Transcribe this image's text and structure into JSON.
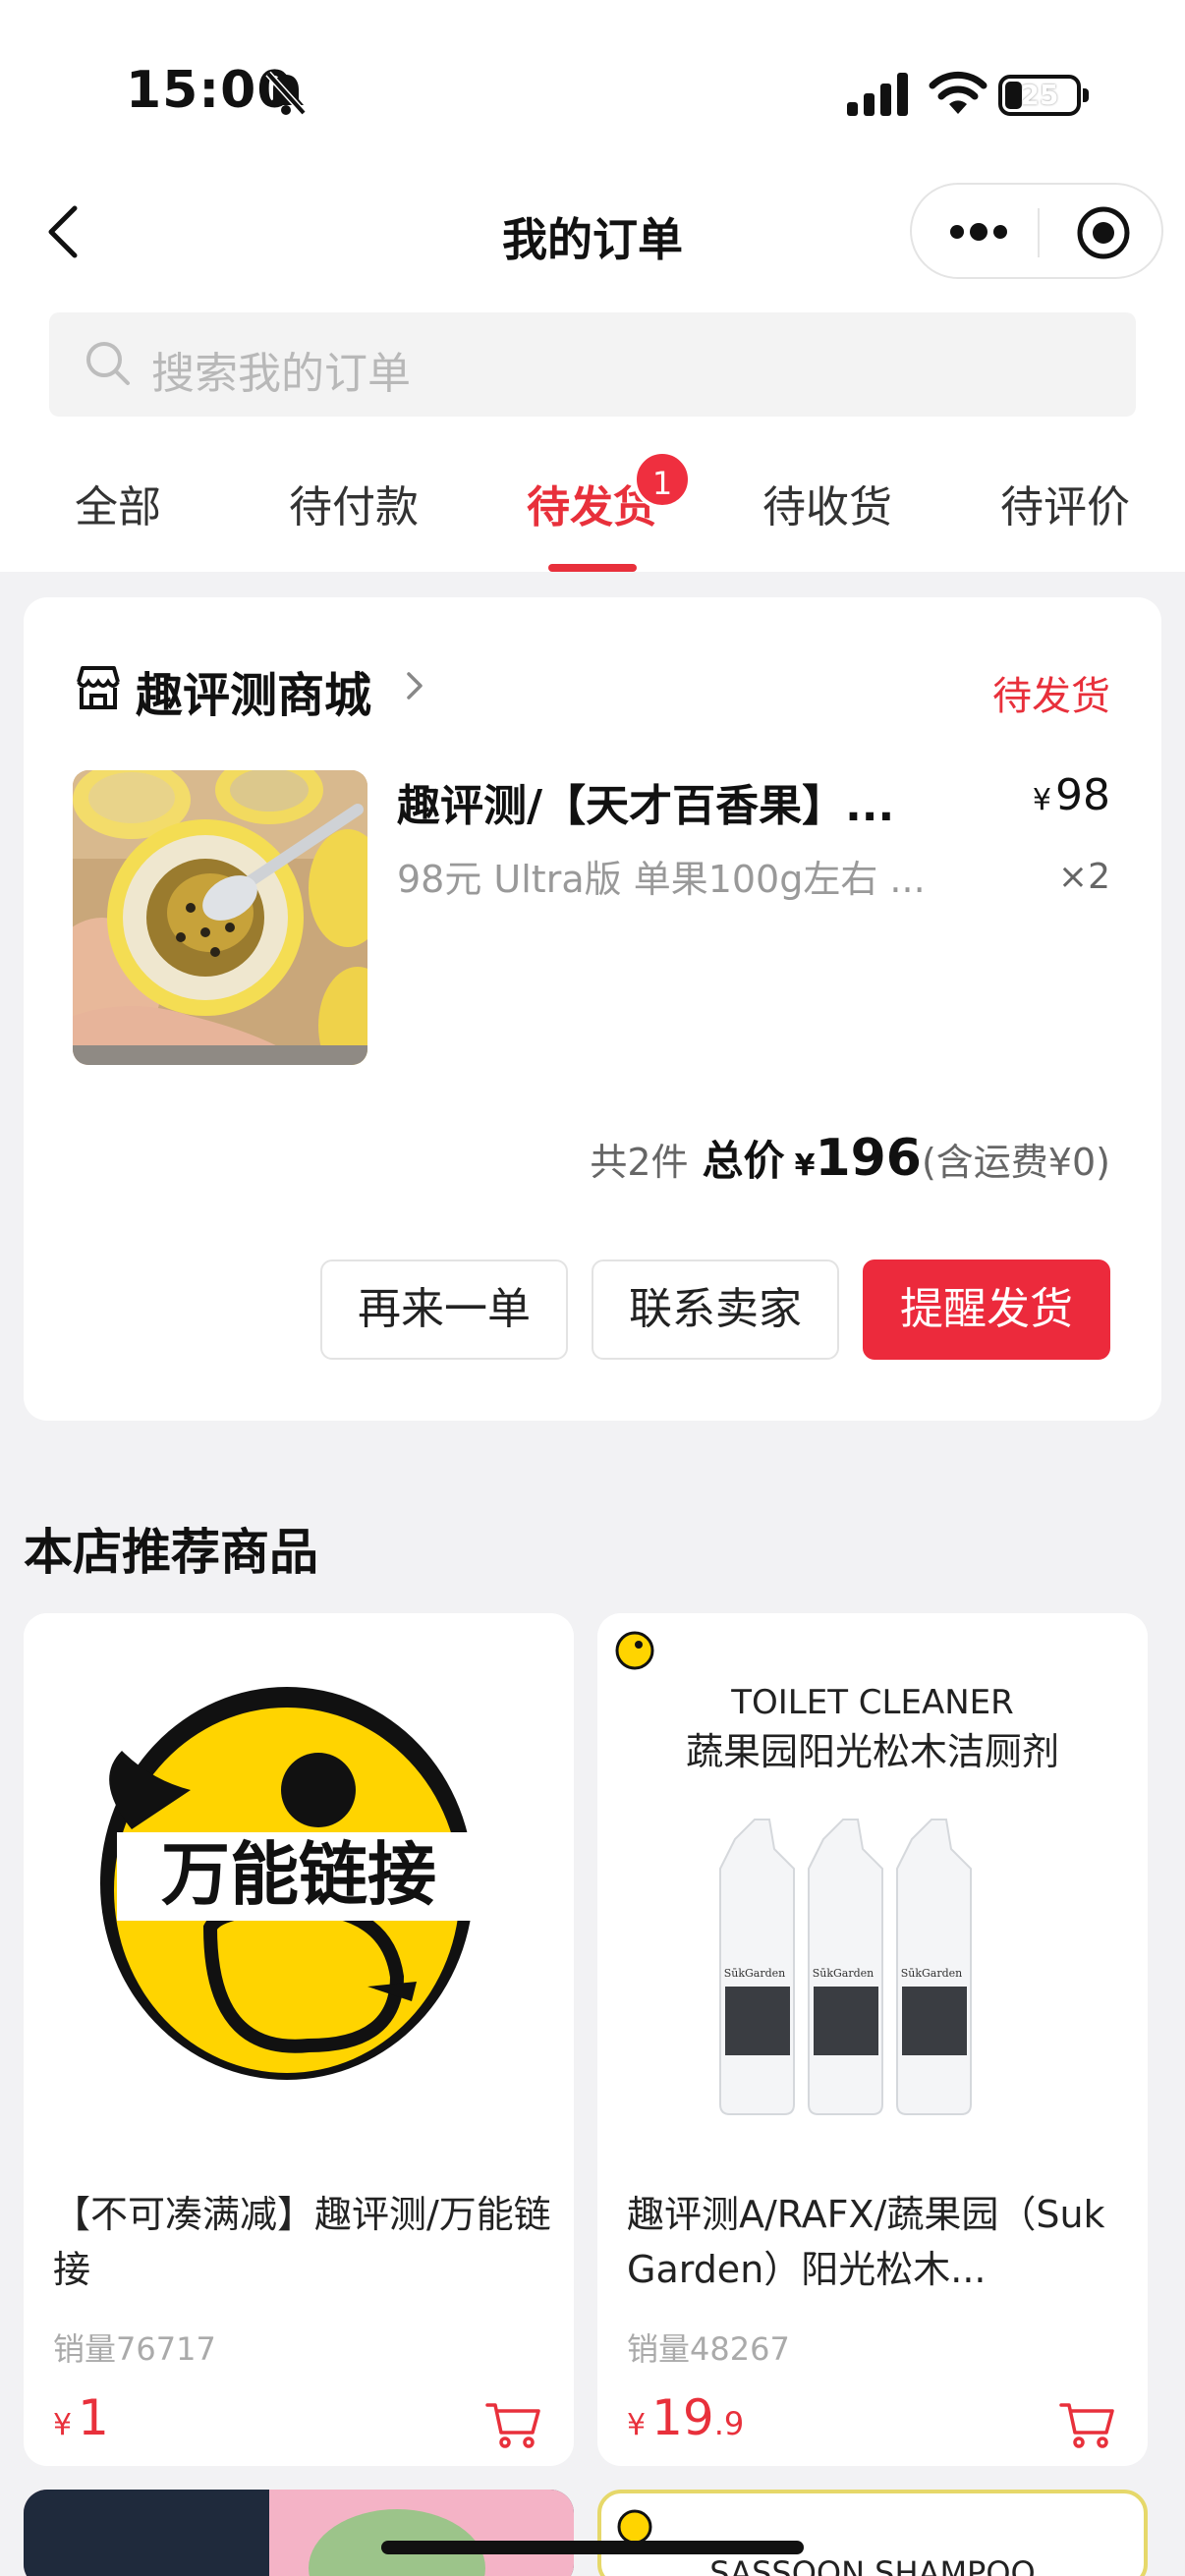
{
  "status": {
    "time": "15:00",
    "battery": "25"
  },
  "nav": {
    "title": "我的订单"
  },
  "search": {
    "placeholder": "搜索我的订单"
  },
  "tabs": [
    {
      "label": "全部"
    },
    {
      "label": "待付款"
    },
    {
      "label": "待发货",
      "active": true,
      "badge": "1"
    },
    {
      "label": "待收货"
    },
    {
      "label": "待评价"
    }
  ],
  "order": {
    "shop_name": "趣评测商城",
    "status": "待发货",
    "product_title": "趣评测/【天才百香果】...",
    "product_spec": "98元 Ultra版 单果100g左右 ...",
    "currency": "¥",
    "price": "98",
    "qty": "×2",
    "count_text": "共2件",
    "total_label": "总价",
    "total_amount": "196",
    "shipping_text": "(含运费¥0)",
    "buttons": {
      "reorder": "再来一单",
      "contact": "联系卖家",
      "remind": "提醒发货"
    }
  },
  "recommend": {
    "title": "本店推荐商品",
    "items": [
      {
        "image_text": "万能链接",
        "title": "【不可凑满减】趣评测/万能链接",
        "sales": "销量76717",
        "currency": "¥",
        "price_int": "1",
        "price_dec": ""
      },
      {
        "image_caption_en": "TOILET CLEANER",
        "image_caption_cn": "蔬果园阳光松木洁厕剂",
        "image_brand": "SūkGarden",
        "title": "趣评测A/RAFX/蔬果园（Suk Garden）阳光松木...",
        "sales": "销量48267",
        "currency": "¥",
        "price_int": "19",
        "price_dec": ".9"
      }
    ],
    "partial_caption": "SASSOON SHAMPOO"
  },
  "colors": {
    "accent": "#e8303b",
    "page_bg": "#f2f2f4",
    "duck_yellow": "#ffd400"
  }
}
